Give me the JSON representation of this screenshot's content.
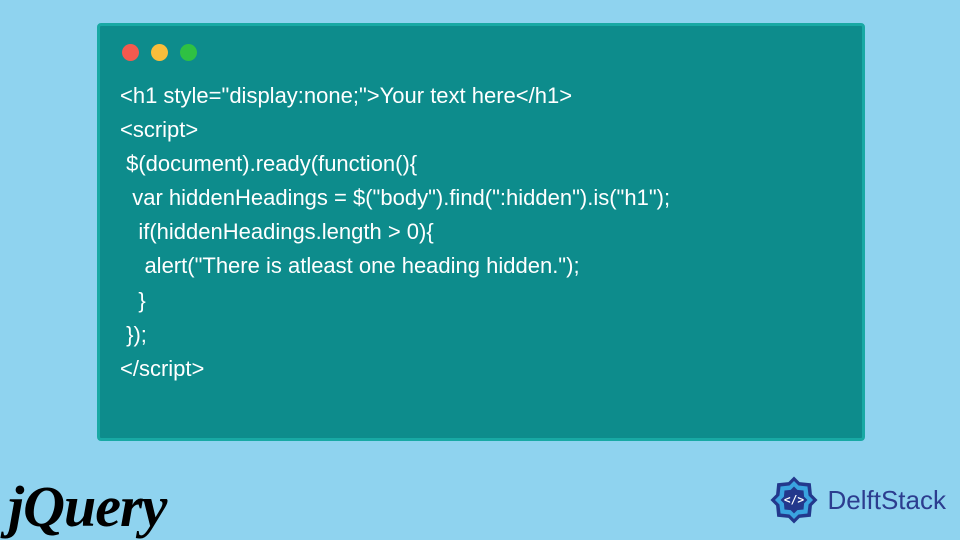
{
  "code": {
    "line1": "<h1 style=\"display:none;\">Your text here</h1>",
    "line2": "<script>",
    "line3": " $(document).ready(function(){",
    "line4": "  var hiddenHeadings = $(\"body\").find(\":hidden\").is(\"h1\");",
    "line5": "   if(hiddenHeadings.length > 0){",
    "line6": "    alert(\"There is atleast one heading hidden.\");",
    "line7": "   }",
    "line8": " });",
    "line9": "</script>"
  },
  "brand": {
    "jquery": "jQuery",
    "delft": "DelftStack"
  },
  "colors": {
    "page_bg": "#8fd3ef",
    "card_bg": "#0d8c8c",
    "card_border": "#18a9a4",
    "code_text": "#ffffff",
    "delft_text": "#2c3d8f",
    "delft_icon_outer": "#23388c",
    "delft_icon_inner": "#3aa4e0"
  }
}
